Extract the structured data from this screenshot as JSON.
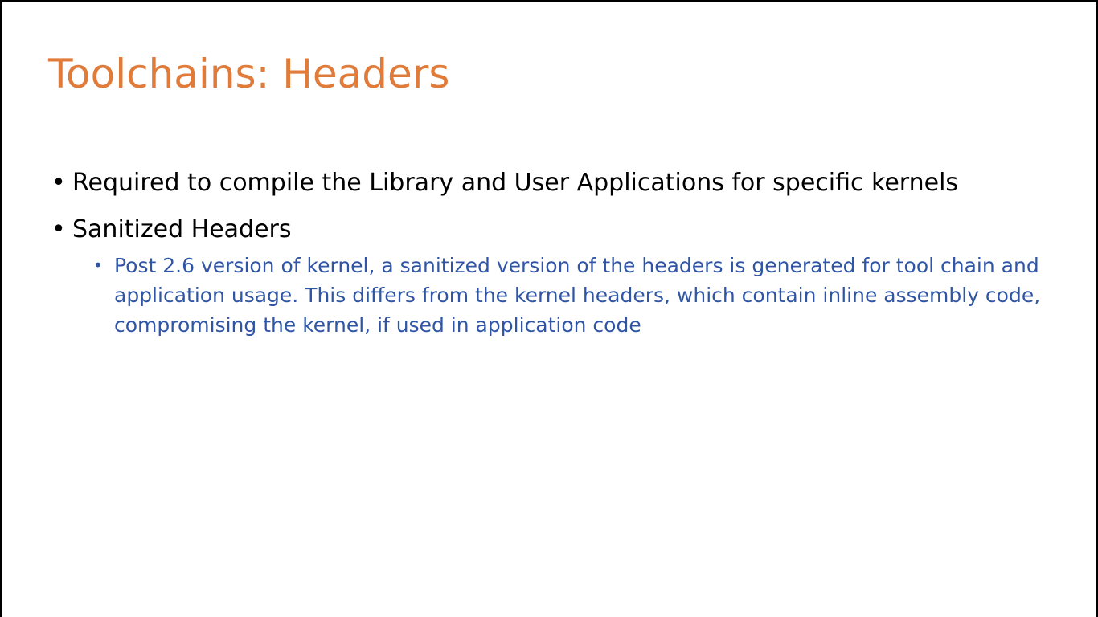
{
  "slide": {
    "title": "Toolchains: Headers",
    "bullets": [
      {
        "marker": "•",
        "text": "Required to compile the Library and User Applications for specific kernels"
      },
      {
        "marker": "•",
        "text": "Sanitized Headers"
      }
    ],
    "sub_bullets": [
      {
        "marker": "•",
        "text": "Post 2.6 version of kernel, a sanitized version of the headers is generated for tool chain and application usage. This differs from the kernel headers, which contain inline assembly code, compromising the kernel, if used in application code"
      }
    ],
    "colors": {
      "title": "#e07b39",
      "body": "#000000",
      "sub_body": "#2f55a4"
    }
  }
}
